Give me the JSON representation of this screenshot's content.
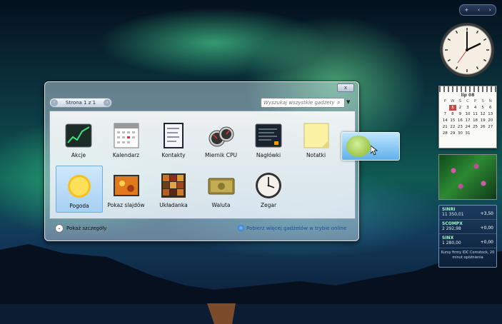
{
  "window": {
    "close_label": "x",
    "pager": {
      "prev": "‹",
      "label": "Strona 1 z 1",
      "next": "›"
    },
    "search": {
      "placeholder": "Wyszukaj wszystkie gadżety"
    },
    "gadgets": [
      {
        "label": "Akcje",
        "icon": "stocks-icon"
      },
      {
        "label": "Kalendarz",
        "icon": "calendar-icon"
      },
      {
        "label": "Kontakty",
        "icon": "contacts-icon"
      },
      {
        "label": "Miernik CPU",
        "icon": "cpu-meter-icon"
      },
      {
        "label": "Nagłówki",
        "icon": "headlines-icon"
      },
      {
        "label": "Notatki",
        "icon": "notes-icon"
      },
      {
        "label": "Pogoda",
        "icon": "weather-icon",
        "selected": true
      },
      {
        "label": "Pokaz slajdów",
        "icon": "slideshow-icon"
      },
      {
        "label": "Układanka",
        "icon": "puzzle-icon"
      },
      {
        "label": "Waluta",
        "icon": "currency-icon"
      },
      {
        "label": "Zegar",
        "icon": "clock-icon"
      }
    ],
    "details_label": "Pokaż szczegóły",
    "more_link": "Pobierz więcej gadżetów w trybie online"
  },
  "sidebar": {
    "nav": {
      "add": "+",
      "prev": "‹",
      "next": "›"
    },
    "calendar": {
      "month_label": "lip 08",
      "day_headers": [
        "P",
        "W",
        "Ś",
        "C",
        "P",
        "S",
        "N"
      ],
      "days": [
        "",
        "1",
        "2",
        "3",
        "4",
        "5",
        "6",
        "7",
        "8",
        "9",
        "10",
        "11",
        "12",
        "13",
        "14",
        "15",
        "16",
        "17",
        "18",
        "19",
        "20",
        "21",
        "22",
        "23",
        "24",
        "25",
        "26",
        "27",
        "28",
        "29",
        "30",
        "31",
        "",
        "",
        ""
      ],
      "today": "1"
    },
    "stocks": [
      {
        "name": "SINRI",
        "value": "11 350,01",
        "change": "+3,50"
      },
      {
        "name": "SCOMPX",
        "value": "2 292,98",
        "change": "+0,00"
      },
      {
        "name": "SINX",
        "value": "1 280,00",
        "change": "+0,00"
      }
    ],
    "stocks_footer": "Kursy firmy IDC Comstock, 20 minut opóźnienia"
  },
  "colors": {
    "accent": "#2663b0",
    "selection": "#a6d0f3"
  }
}
